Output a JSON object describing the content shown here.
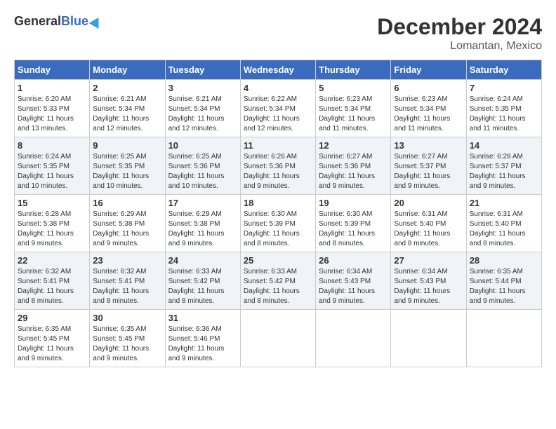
{
  "header": {
    "logo_general": "General",
    "logo_blue": "Blue",
    "month_title": "December 2024",
    "location": "Lomantan, Mexico"
  },
  "days_of_week": [
    "Sunday",
    "Monday",
    "Tuesday",
    "Wednesday",
    "Thursday",
    "Friday",
    "Saturday"
  ],
  "weeks": [
    [
      {
        "day": "1",
        "info": "Sunrise: 6:20 AM\nSunset: 5:33 PM\nDaylight: 11 hours\nand 13 minutes."
      },
      {
        "day": "2",
        "info": "Sunrise: 6:21 AM\nSunset: 5:34 PM\nDaylight: 11 hours\nand 12 minutes."
      },
      {
        "day": "3",
        "info": "Sunrise: 6:21 AM\nSunset: 5:34 PM\nDaylight: 11 hours\nand 12 minutes."
      },
      {
        "day": "4",
        "info": "Sunrise: 6:22 AM\nSunset: 5:34 PM\nDaylight: 11 hours\nand 12 minutes."
      },
      {
        "day": "5",
        "info": "Sunrise: 6:23 AM\nSunset: 5:34 PM\nDaylight: 11 hours\nand 11 minutes."
      },
      {
        "day": "6",
        "info": "Sunrise: 6:23 AM\nSunset: 5:34 PM\nDaylight: 11 hours\nand 11 minutes."
      },
      {
        "day": "7",
        "info": "Sunrise: 6:24 AM\nSunset: 5:35 PM\nDaylight: 11 hours\nand 11 minutes."
      }
    ],
    [
      {
        "day": "8",
        "info": "Sunrise: 6:24 AM\nSunset: 5:35 PM\nDaylight: 11 hours\nand 10 minutes."
      },
      {
        "day": "9",
        "info": "Sunrise: 6:25 AM\nSunset: 5:35 PM\nDaylight: 11 hours\nand 10 minutes."
      },
      {
        "day": "10",
        "info": "Sunrise: 6:25 AM\nSunset: 5:36 PM\nDaylight: 11 hours\nand 10 minutes."
      },
      {
        "day": "11",
        "info": "Sunrise: 6:26 AM\nSunset: 5:36 PM\nDaylight: 11 hours\nand 9 minutes."
      },
      {
        "day": "12",
        "info": "Sunrise: 6:27 AM\nSunset: 5:36 PM\nDaylight: 11 hours\nand 9 minutes."
      },
      {
        "day": "13",
        "info": "Sunrise: 6:27 AM\nSunset: 5:37 PM\nDaylight: 11 hours\nand 9 minutes."
      },
      {
        "day": "14",
        "info": "Sunrise: 6:28 AM\nSunset: 5:37 PM\nDaylight: 11 hours\nand 9 minutes."
      }
    ],
    [
      {
        "day": "15",
        "info": "Sunrise: 6:28 AM\nSunset: 5:38 PM\nDaylight: 11 hours\nand 9 minutes."
      },
      {
        "day": "16",
        "info": "Sunrise: 6:29 AM\nSunset: 5:38 PM\nDaylight: 11 hours\nand 9 minutes."
      },
      {
        "day": "17",
        "info": "Sunrise: 6:29 AM\nSunset: 5:38 PM\nDaylight: 11 hours\nand 9 minutes."
      },
      {
        "day": "18",
        "info": "Sunrise: 6:30 AM\nSunset: 5:39 PM\nDaylight: 11 hours\nand 8 minutes."
      },
      {
        "day": "19",
        "info": "Sunrise: 6:30 AM\nSunset: 5:39 PM\nDaylight: 11 hours\nand 8 minutes."
      },
      {
        "day": "20",
        "info": "Sunrise: 6:31 AM\nSunset: 5:40 PM\nDaylight: 11 hours\nand 8 minutes."
      },
      {
        "day": "21",
        "info": "Sunrise: 6:31 AM\nSunset: 5:40 PM\nDaylight: 11 hours\nand 8 minutes."
      }
    ],
    [
      {
        "day": "22",
        "info": "Sunrise: 6:32 AM\nSunset: 5:41 PM\nDaylight: 11 hours\nand 8 minutes."
      },
      {
        "day": "23",
        "info": "Sunrise: 6:32 AM\nSunset: 5:41 PM\nDaylight: 11 hours\nand 8 minutes."
      },
      {
        "day": "24",
        "info": "Sunrise: 6:33 AM\nSunset: 5:42 PM\nDaylight: 11 hours\nand 8 minutes."
      },
      {
        "day": "25",
        "info": "Sunrise: 6:33 AM\nSunset: 5:42 PM\nDaylight: 11 hours\nand 8 minutes."
      },
      {
        "day": "26",
        "info": "Sunrise: 6:34 AM\nSunset: 5:43 PM\nDaylight: 11 hours\nand 9 minutes."
      },
      {
        "day": "27",
        "info": "Sunrise: 6:34 AM\nSunset: 5:43 PM\nDaylight: 11 hours\nand 9 minutes."
      },
      {
        "day": "28",
        "info": "Sunrise: 6:35 AM\nSunset: 5:44 PM\nDaylight: 11 hours\nand 9 minutes."
      }
    ],
    [
      {
        "day": "29",
        "info": "Sunrise: 6:35 AM\nSunset: 5:45 PM\nDaylight: 11 hours\nand 9 minutes."
      },
      {
        "day": "30",
        "info": "Sunrise: 6:35 AM\nSunset: 5:45 PM\nDaylight: 11 hours\nand 9 minutes."
      },
      {
        "day": "31",
        "info": "Sunrise: 6:36 AM\nSunset: 5:46 PM\nDaylight: 11 hours\nand 9 minutes."
      },
      null,
      null,
      null,
      null
    ]
  ]
}
